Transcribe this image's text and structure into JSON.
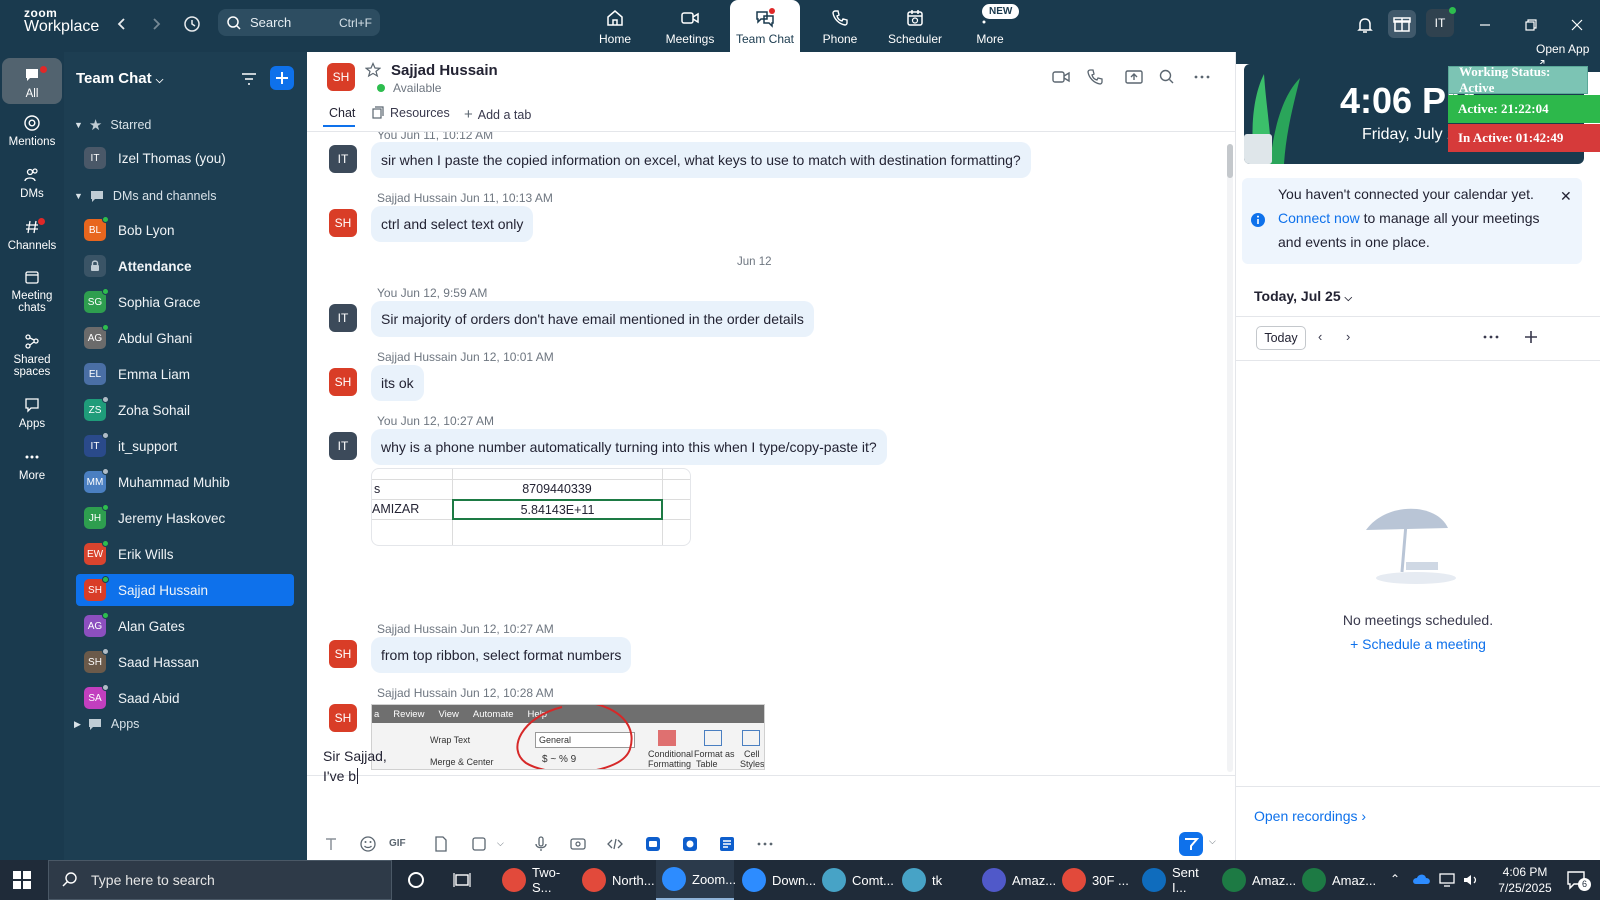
{
  "app": {
    "logo_top": "zoom",
    "logo_bottom": "Workplace"
  },
  "search": {
    "label": "Search",
    "shortcut": "Ctrl+F"
  },
  "nav_tabs": [
    {
      "label": "Home",
      "icon": "home-icon"
    },
    {
      "label": "Meetings",
      "icon": "video-icon"
    },
    {
      "label": "Team Chat",
      "icon": "chat-icon",
      "active": true
    },
    {
      "label": "Phone",
      "icon": "phone-icon"
    },
    {
      "label": "Scheduler",
      "icon": "calendar-icon"
    },
    {
      "label": "More",
      "icon": "more-icon"
    }
  ],
  "new_badge": "NEW",
  "profile_initials": "IT",
  "rail": [
    {
      "label": "All"
    },
    {
      "label": "Mentions"
    },
    {
      "label": "DMs"
    },
    {
      "label": "Channels"
    },
    {
      "label": "Meeting chats"
    },
    {
      "label": "Shared spaces"
    },
    {
      "label": "Apps"
    },
    {
      "label": "More"
    }
  ],
  "sidebar": {
    "title": "Team Chat",
    "starred": "Starred",
    "dms": "DMs and channels",
    "apps": "Apps",
    "starred_items": [
      {
        "initials": "IT",
        "name": "Izel Thomas (you)",
        "color": "#4a5868"
      }
    ],
    "items": [
      {
        "initials": "BL",
        "name": "Bob Lyon",
        "color": "#e8661e",
        "status": "#2dbd4e"
      },
      {
        "initials": "",
        "name": "Attendance",
        "color": "#4a5868",
        "bold": true,
        "lock": true
      },
      {
        "initials": "SG",
        "name": "Sophia Grace",
        "color": "#2e9e4f",
        "status": "#2dbd4e"
      },
      {
        "initials": "AG",
        "name": "Abdul Ghani",
        "color": "#6b6b6b",
        "status": "#2dbd4e"
      },
      {
        "initials": "EL",
        "name": "Emma Liam",
        "color": "#4a6fa5"
      },
      {
        "initials": "ZS",
        "name": "Zoha Sohail",
        "color": "#1f9c7a",
        "status": "#b0bcc6"
      },
      {
        "initials": "IT",
        "name": "it_support",
        "color": "#2a4a8a",
        "status": "#b0bcc6"
      },
      {
        "initials": "MM",
        "name": "Muhammad Muhib",
        "color": "#4a7fc1",
        "status": "#b0bcc6"
      },
      {
        "initials": "JH",
        "name": "Jeremy Haskovec",
        "color": "#2e9e4f",
        "status": "#2dbd4e"
      },
      {
        "initials": "EW",
        "name": "Erik Wills",
        "color": "#d9442e",
        "status": "#2dbd4e"
      },
      {
        "initials": "SH",
        "name": "Sajjad Hussain",
        "color": "#d93d27",
        "selected": true,
        "status": "#2dbd4e"
      },
      {
        "initials": "AG",
        "name": "Alan Gates",
        "color": "#8c4fbf",
        "status": "#2dbd4e"
      },
      {
        "initials": "SH",
        "name": "Saad Hassan",
        "color": "#6b5a4a",
        "status": "#b0bcc6"
      },
      {
        "initials": "SA",
        "name": "Saad Abid",
        "color": "#c23fbf",
        "status": "#b0bcc6"
      }
    ]
  },
  "chat": {
    "contact_initials": "SH",
    "contact_name": "Sajjad Hussain",
    "contact_status": "Available",
    "tabs": [
      "Chat",
      "Resources",
      "Add a tab"
    ],
    "date_sep": "Jun 12",
    "messages": [
      {
        "meta": "You Jun 11, 10:12 AM",
        "av": "IT",
        "text": "sir when I paste the copied information on excel, what keys to use to match with destination formatting?"
      },
      {
        "meta": "Sajjad Hussain Jun 11, 10:13 AM",
        "av": "SH",
        "text": "ctrl and select text only"
      },
      {
        "meta": "You Jun 12, 9:59 AM",
        "av": "IT",
        "text": "Sir majority of orders don't have email mentioned in the order details"
      },
      {
        "meta": "Sajjad Hussain Jun 12, 10:01 AM",
        "av": "SH",
        "text": "its ok"
      },
      {
        "meta": "You Jun 12, 10:27 AM",
        "av": "IT",
        "text": "why is a phone number automatically turning into this when I type/copy-paste it?"
      },
      {
        "meta": "Sajjad Hussain Jun 12, 10:27 AM",
        "av": "SH",
        "text": "from top ribbon, select format numbers"
      },
      {
        "meta": "Sajjad Hussain Jun 12, 10:28 AM",
        "av": "SH",
        "text": ""
      }
    ],
    "excel_snip": {
      "r1c1": "s",
      "r1c2": "8709440339",
      "r2c1": "AMIZAR",
      "r2c2": "5.84143E+11"
    },
    "ribbon_snip": {
      "tabs": [
        "a",
        "Review",
        "View",
        "Automate",
        "Help"
      ],
      "wrap": "Wrap Text",
      "merge": "Merge & Center",
      "general": "General",
      "cond": "Conditional",
      "cond2": "Formatting",
      "fmt": "Format as",
      "fmt2": "Table",
      "cell": "Cell",
      "cell2": "Styles",
      "pct": "$ ~ % 9"
    },
    "compose_line1": "Sir Sajjad,",
    "compose_line2": "I've b"
  },
  "right": {
    "open_app": "Open App",
    "clock_time": "4:06 PM",
    "clock_date": "Friday, July 25",
    "cal_note_pre": "You haven't connected your calendar yet. ",
    "cal_note_link": "Connect now",
    "cal_note_post": " to manage all your meetings and events in one place.",
    "today_header": "Today, Jul 25",
    "today_btn": "Today",
    "no_meetings": "No meetings scheduled.",
    "schedule": "Schedule a meeting",
    "open_recordings": "Open recordings"
  },
  "status_overlay": {
    "working": "Working Status: Active",
    "active": "Active: 21:22:04",
    "inactive": "In Active: 01:42:49",
    "active_color": "#2db84b",
    "inactive_color": "#d63a3a"
  },
  "taskbar": {
    "search": "Type here to search",
    "apps": [
      {
        "label": "Two-S...",
        "color": "#e24a3b"
      },
      {
        "label": "North...",
        "color": "#e24a3b"
      },
      {
        "label": "Zoom...",
        "color": "#2d8cff"
      },
      {
        "label": "Down...",
        "color": "#2d8cff"
      },
      {
        "label": "Comt...",
        "color": "#47a3c6"
      },
      {
        "label": "tk",
        "color": "#47a3c6"
      },
      {
        "label": "Amaz...",
        "color": "#5059c9"
      },
      {
        "label": "30F ...",
        "color": "#e24a3b"
      },
      {
        "label": "Sent I...",
        "color": "#0f6cbd"
      },
      {
        "label": "Amaz...",
        "color": "#1d7a44"
      },
      {
        "label": "Amaz...",
        "color": "#1d7a44"
      }
    ],
    "time": "4:06 PM",
    "date": "7/25/2025",
    "notif_count": "6"
  }
}
